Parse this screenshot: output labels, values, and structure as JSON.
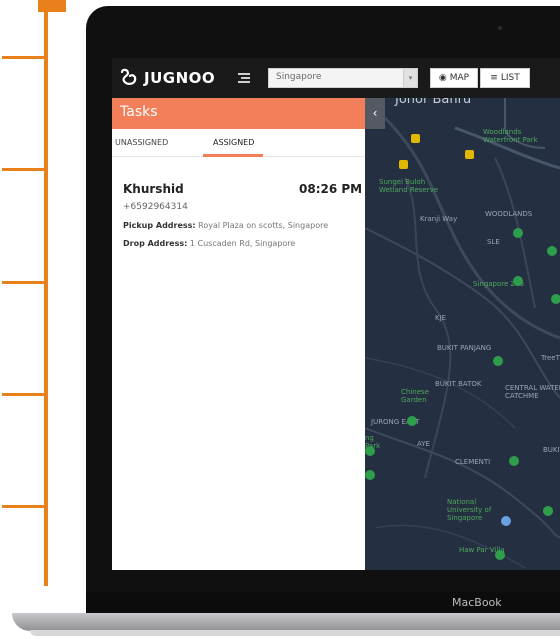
{
  "app": {
    "logo_text": "JUGNOO",
    "brand_label": "MacBook"
  },
  "header": {
    "city_value": "Singapore",
    "map_label": "MAP",
    "list_label": "LIST"
  },
  "tasks": {
    "title": "Tasks",
    "tabs": [
      "UNASSIGNED",
      "ASSIGNED"
    ],
    "active_tab": "ASSIGNED",
    "items": [
      {
        "name": "Khurshid",
        "time": "08:26 PM",
        "phone": "+6592964314",
        "pickup_label": "Pickup Address:",
        "pickup_value": "Royal Plaza on scotts, Singapore",
        "drop_label": "Drop Address:",
        "drop_value": "1 Cuscaden Rd, Singapore"
      }
    ]
  },
  "map": {
    "labels": {
      "johor_bahru": "Johor Bahru",
      "woodlands": "Woodlands Waterfront Park",
      "sungei_buloh": "Sungei Buloh Wetland Reserve",
      "zoo": "Singapore Zoo",
      "chinese_garden": "Chinese Garden",
      "treetop": "TreeT",
      "nus": "National University of Singapore",
      "haw_par": "Haw Par Villa",
      "jurong_east": "JURONG EAST",
      "bukit_batok": "BUKIT BATOK",
      "bukit_panjang": "BUKIT PANJANG",
      "clementi": "CLEMENTI",
      "central": "CENTRAL WATER CATCHME",
      "woodlands_town": "WOODLANDS",
      "kranji": "Kranji Way",
      "sle": "SLE",
      "kje": "KJE",
      "ayer": "AYE",
      "ng_park": "ng Park",
      "bukit": "BUKIT"
    }
  },
  "colors": {
    "accent": "#f37f5a",
    "timeline": "#e8801c",
    "map_bg": "#243041"
  }
}
